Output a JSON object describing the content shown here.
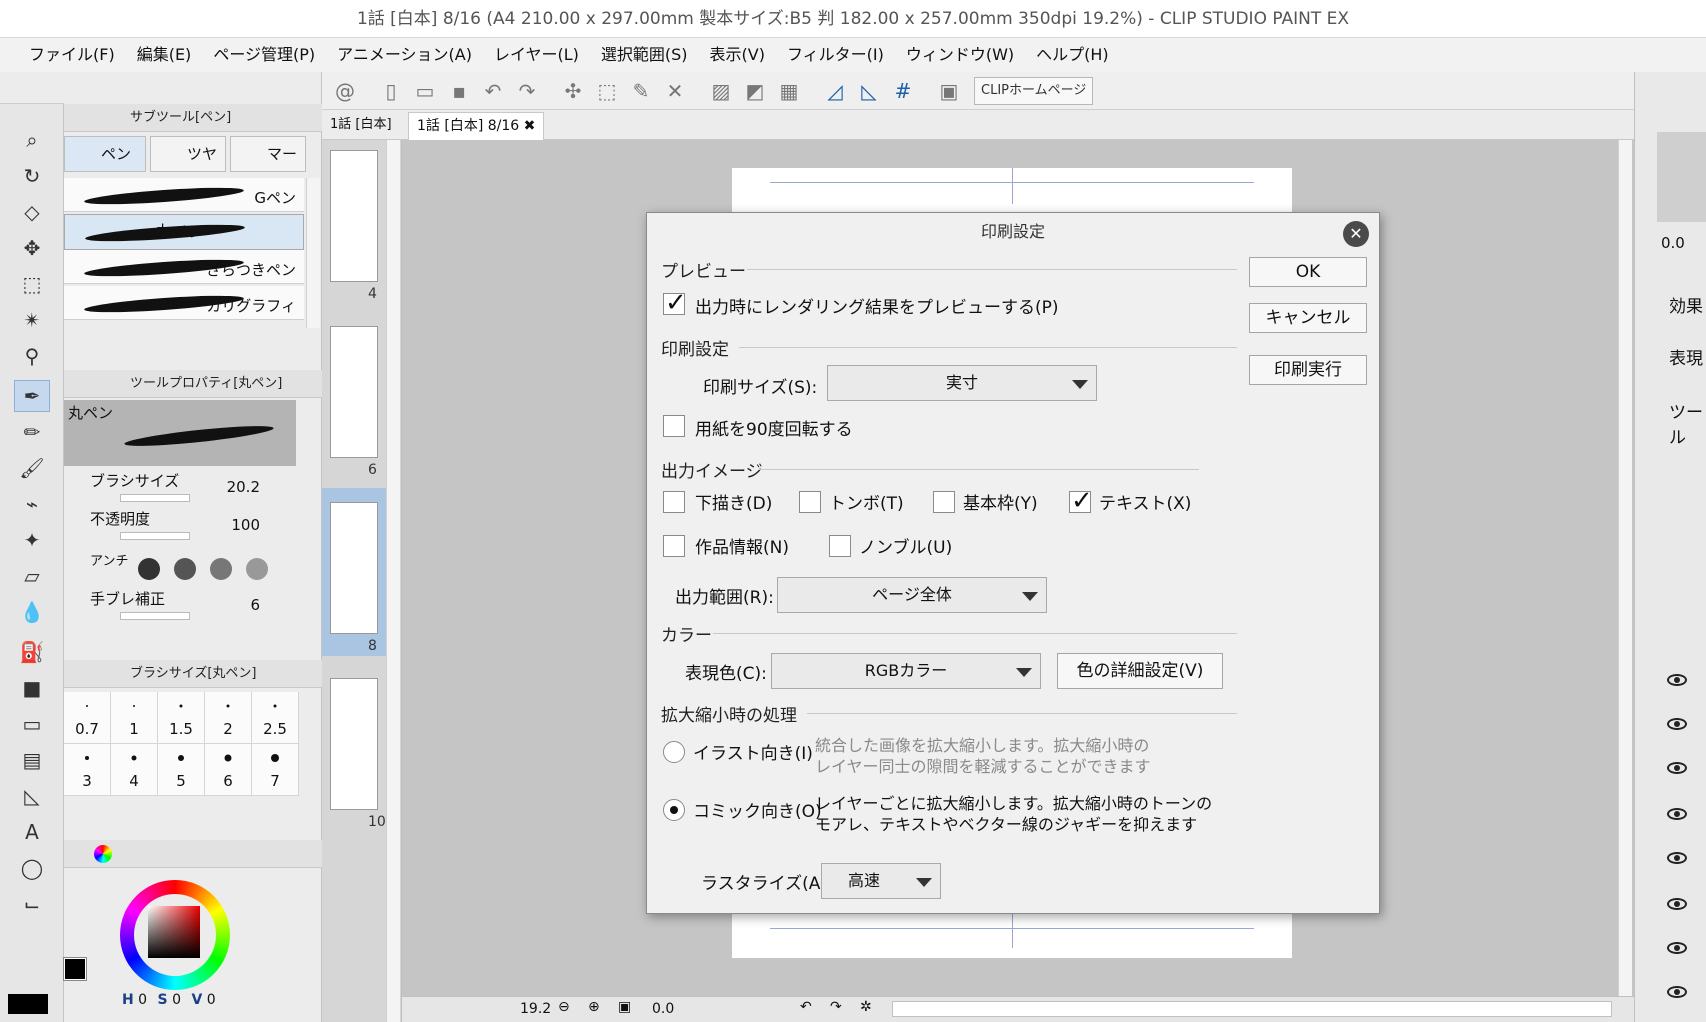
{
  "window": {
    "title": "1話 [白本] 8/16 (A4 210.00 x 297.00mm 製本サイズ:B5 判 182.00 x 257.00mm 350dpi 19.2%)  - CLIP STUDIO PAINT EX"
  },
  "menu": [
    "ファイル(F)",
    "編集(E)",
    "ページ管理(P)",
    "アニメーション(A)",
    "レイヤー(L)",
    "選択範囲(S)",
    "表示(V)",
    "フィルター(I)",
    "ウィンドウ(W)",
    "ヘルプ(H)"
  ],
  "toolbar": {
    "clip_home_label": "CLIPホームページ"
  },
  "subtool": {
    "header": "サブツール[ペン]",
    "tabs": [
      "ペン",
      "ツヤベ",
      "マーカ"
    ],
    "brushes": [
      "Gペン",
      "丸ペン",
      "ざらつきペン",
      "カリグラフィ"
    ]
  },
  "toolprop": {
    "header": "ツールプロパティ[丸ペン]",
    "tool_name": "丸ペン",
    "brush_size_label": "ブラシサイズ",
    "brush_size_value": "20.2",
    "opacity_label": "不透明度",
    "opacity_value": "100",
    "antialias_label": "アンチ",
    "stabilize_label": "手ブレ補正",
    "stabilize_value": "6"
  },
  "brushsize": {
    "header": "ブラシサイズ[丸ペン]",
    "sizes": [
      "0.7",
      "1",
      "1.5",
      "2",
      "2.5",
      "3",
      "4",
      "5",
      "6",
      "7"
    ]
  },
  "color": {
    "main": "#000000",
    "h_label": "H",
    "h_value": "0",
    "s_label": "S",
    "s_value": "0",
    "v_label": "V",
    "v_value": "0"
  },
  "navigator": {
    "header": "1話 [白本]",
    "page_numbers": [
      "4",
      "6",
      "8",
      "10"
    ]
  },
  "canvas": {
    "tab_label": "1話 [白本]    8/16",
    "zoom": "19.2",
    "rotation": "0.0"
  },
  "right_panel": {
    "value": "0.0",
    "effect_label": "効果",
    "expression_label": "表現",
    "tool_label": "ツール"
  },
  "dialog": {
    "title": "印刷設定",
    "ok_label": "OK",
    "cancel_label": "キャンセル",
    "execute_label": "印刷実行",
    "preview": {
      "section": "プレビュー",
      "checkbox_label": "出力時にレンダリング結果をプレビューする(P)",
      "checked": true
    },
    "print_settings": {
      "section": "印刷設定",
      "size_label": "印刷サイズ(S):",
      "size_value": "実寸",
      "rotate_label": "用紙を90度回転する",
      "rotate_checked": false
    },
    "output_image": {
      "section": "出力イメージ",
      "options": [
        {
          "label": "下描き(D)",
          "checked": false
        },
        {
          "label": "トンボ(T)",
          "checked": false
        },
        {
          "label": "基本枠(Y)",
          "checked": false
        },
        {
          "label": "テキスト(X)",
          "checked": true
        },
        {
          "label": "作品情報(N)",
          "checked": false
        },
        {
          "label": "ノンブル(U)",
          "checked": false
        }
      ],
      "range_label": "出力範囲(R):",
      "range_value": "ページ全体"
    },
    "color": {
      "section": "カラー",
      "expression_label": "表現色(C):",
      "expression_value": "RGBカラー",
      "detail_button": "色の詳細設定(V)"
    },
    "scaling": {
      "section": "拡大縮小時の処理",
      "illust_label": "イラスト向き(I)",
      "illust_desc1": "統合した画像を拡大縮小します。拡大縮小時の",
      "illust_desc2": "レイヤー同士の隙間を軽減することができます",
      "comic_label": "コミック向き(O)",
      "comic_desc1": "レイヤーごとに拡大縮小します。拡大縮小時のトーンの",
      "comic_desc2": "モアレ、テキストやベクター線のジャギーを抑えます",
      "selected": "comic",
      "rasterize_label": "ラスタライズ(A):",
      "rasterize_value": "高速"
    }
  }
}
